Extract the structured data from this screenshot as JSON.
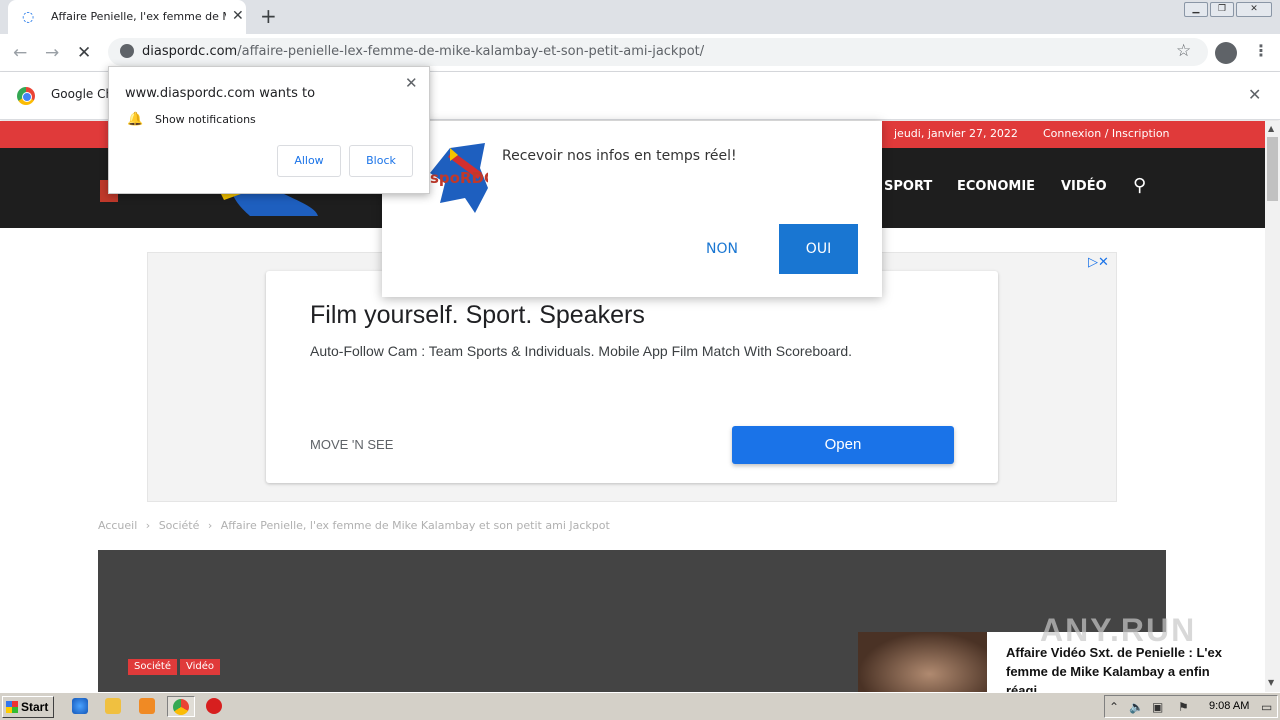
{
  "browser": {
    "tab_title": "Affaire Penielle, l'ex femme de Mike Kalambay et son petit ami Jackpot",
    "tab_loading_icon": "loading-spinner",
    "new_tab_label": "+",
    "url_domain": "diaspordc.com",
    "url_path": "/affaire-penielle-lex-femme-de-mike-kalambay-et-son-petit-ami-jackpot/",
    "infobar_text": "Google Ch"
  },
  "permission_popup": {
    "title": "www.diaspordc.com wants to",
    "permission": "Show notifications",
    "allow_label": "Allow",
    "block_label": "Block"
  },
  "push_popup": {
    "text": "Recevoir nos infos en temps réel!",
    "no_label": "NON",
    "yes_label": "OUI",
    "logo_text": "spoRDC"
  },
  "site": {
    "date": "jeudi, janvier 27, 2022",
    "login": "Connexion / Inscription",
    "nav": [
      "SPORT",
      "ECONOMIE",
      "VIDÉO"
    ]
  },
  "ad": {
    "title": "Film yourself. Sport. Speakers",
    "description": "Auto-Follow Cam : Team Sports & Individuals. Mobile App Film Match With Scoreboard.",
    "brand": "MOVE 'N SEE",
    "cta": "Open"
  },
  "breadcrumb": {
    "home": "Accueil",
    "category": "Société",
    "current": "Affaire Penielle, l'ex femme de Mike Kalambay et son petit ami Jackpot",
    "separator": "›"
  },
  "featured": {
    "tags": [
      "Société",
      "Vidéo"
    ],
    "related_title": "Affaire Vidéo Sxt. de Penielle : L'ex femme de Mike Kalambay a enfin réagi"
  },
  "watermark": "ANY.RUN",
  "taskbar": {
    "start_label": "Start",
    "clock": "9:08 AM"
  },
  "colors": {
    "site_red": "#e03a3a",
    "site_header": "#1e1e1e",
    "push_blue": "#1976d2",
    "ad_blue": "#1a73e8"
  }
}
